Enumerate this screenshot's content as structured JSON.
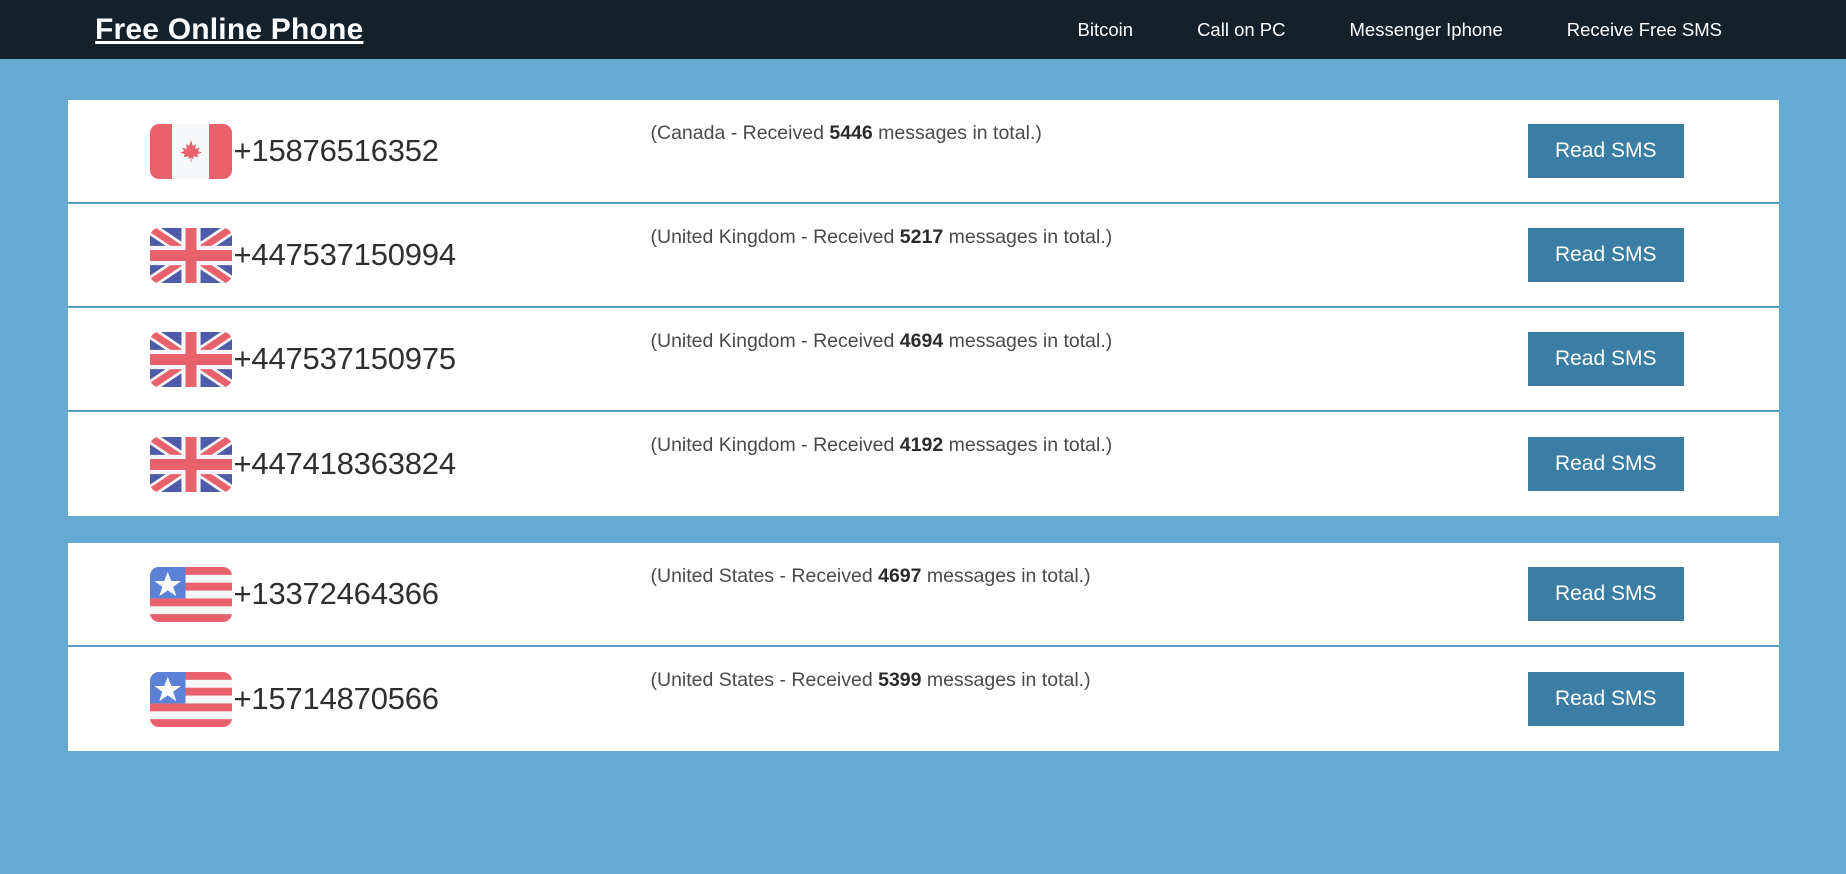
{
  "header": {
    "brand": "Free Online Phone",
    "nav": [
      {
        "label": "Bitcoin"
      },
      {
        "label": "Call on PC"
      },
      {
        "label": "Messenger Iphone"
      },
      {
        "label": "Receive Free SMS"
      }
    ]
  },
  "colors": {
    "page_background": "#64aad2",
    "navbar_background": "#14212b",
    "card_background": "#ffffff",
    "row_divider": "#5b9bc4",
    "button_background": "#3c7ea3",
    "button_text": "#ffffff",
    "flag_red": "#e8616d",
    "flag_blue": "#4e5bab",
    "us_canton_blue": "#5b82d6"
  },
  "groups": [
    {
      "rows": [
        {
          "flag": "canada-flag-icon",
          "country_code": "ca",
          "number": "+15876516352",
          "desc_prefix": "(Canada - Received ",
          "count": "5446",
          "desc_suffix": " messages in total.)",
          "button_label": "Read SMS"
        },
        {
          "flag": "united-kingdom-flag-icon",
          "country_code": "uk",
          "number": "+447537150994",
          "desc_prefix": "(United Kingdom - Received ",
          "count": "5217",
          "desc_suffix": " messages in total.)",
          "button_label": "Read SMS"
        },
        {
          "flag": "united-kingdom-flag-icon",
          "country_code": "uk",
          "number": "+447537150975",
          "desc_prefix": "(United Kingdom - Received ",
          "count": "4694",
          "desc_suffix": " messages in total.)",
          "button_label": "Read SMS"
        },
        {
          "flag": "united-kingdom-flag-icon",
          "country_code": "uk",
          "number": "+447418363824",
          "desc_prefix": "(United Kingdom - Received ",
          "count": "4192",
          "desc_suffix": " messages in total.)",
          "button_label": "Read SMS"
        }
      ]
    },
    {
      "rows": [
        {
          "flag": "united-states-flag-icon",
          "country_code": "us",
          "number": "+13372464366",
          "desc_prefix": "(United States - Received ",
          "count": "4697",
          "desc_suffix": " messages in total.)",
          "button_label": "Read SMS"
        },
        {
          "flag": "united-states-flag-icon",
          "country_code": "us",
          "number": "+15714870566",
          "desc_prefix": "(United States - Received ",
          "count": "5399",
          "desc_suffix": " messages in total.)",
          "button_label": "Read SMS"
        }
      ]
    }
  ]
}
